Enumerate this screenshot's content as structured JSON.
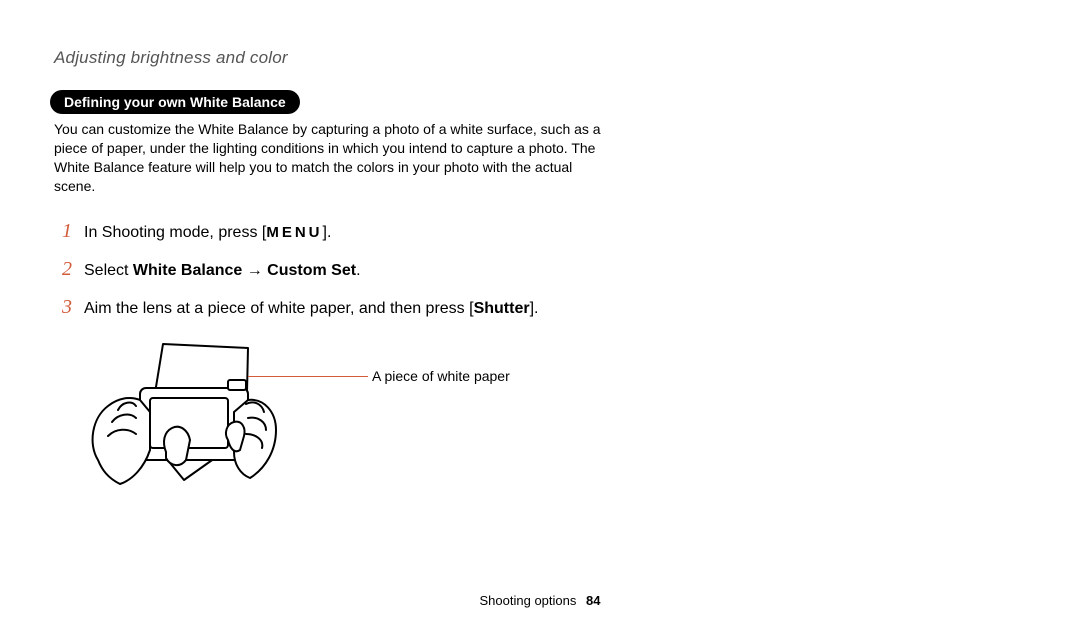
{
  "header": {
    "running_head": "Adjusting brightness and color"
  },
  "section": {
    "title": "Defining your own White Balance",
    "description": "You can customize the White Balance by capturing a photo of a white surface, such as a piece of paper, under the lighting conditions in which you intend to capture a photo. The White Balance feature will help you to match the colors in your photo with the actual scene."
  },
  "steps": [
    {
      "num": "1",
      "pre": "In Shooting mode, press [",
      "menu": "MENU",
      "post": "]."
    },
    {
      "num": "2",
      "pre": "Select ",
      "bold1": "White Balance",
      "mid": " → ",
      "bold2": "Custom Set",
      "post": "."
    },
    {
      "num": "3",
      "pre": "Aim the lens at a piece of white paper, and then press [",
      "bold1": "Shutter",
      "post": "]."
    }
  ],
  "figure": {
    "callout": "A piece of white paper"
  },
  "footer": {
    "section_label": "Shooting options",
    "page_number": "84"
  },
  "colors": {
    "accent": "#D25B3A"
  }
}
